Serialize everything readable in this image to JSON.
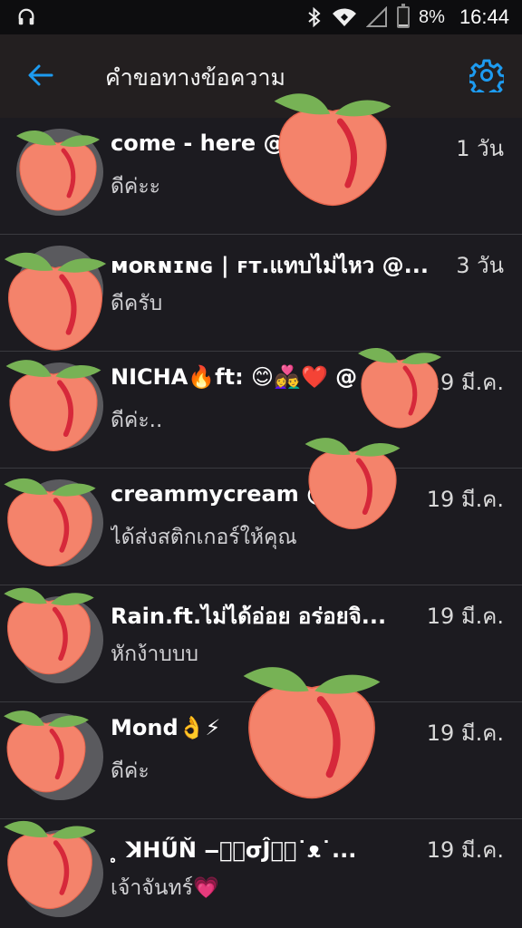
{
  "status_bar": {
    "battery_percent": "8%",
    "battery_level": 0.08,
    "time": "16:44",
    "icons": [
      "headset-icon",
      "bluetooth-icon",
      "wifi-icon",
      "signal-icon",
      "battery-icon"
    ]
  },
  "app_bar": {
    "title": "คำขอทางข้อความ",
    "back_icon": "arrow-left-icon",
    "settings_icon": "gear-icon"
  },
  "colors": {
    "accent": "#1d9bf0",
    "background": "#1c1b20",
    "peach": "#f4836b",
    "leaf": "#77b255"
  },
  "messages": [
    {
      "name": "come - here @",
      "time": "1 วัน",
      "preview": "ดีค่ะะ"
    },
    {
      "name": "ᴍᴏʀɴɪɴɢ | ꜰᴛ.แทบไม่ไหว @...",
      "time": "3 วัน",
      "preview": "ดีครับ"
    },
    {
      "name": "NICHA🔥ft: 😊👩‍❤️‍👨❤️ @",
      "time": "19 มี.ค.",
      "preview": "ดีค่ะ.."
    },
    {
      "name": "creammycream @",
      "time": "19 มี.ค.",
      "preview": "ได้ส่งสติกเกอร์ให้คุณ"
    },
    {
      "name": "Rain.ft.ไม่ได้อ่อย อร่อยจิ...",
      "time": "19 มี.ค.",
      "preview": "หักง้าบบบ"
    },
    {
      "name": "Mond👌⚡",
      "time": "19 มี.ค.",
      "preview": "ดีค่ะ"
    },
    {
      "name": "⃝⃝ ̥ ꓘHŰŇ ‒⃝⃝σĴ⃝⃝˙ᴥ˙...",
      "time": "19 มี.ค.",
      "preview": "เจ้าจันทร์💗"
    }
  ],
  "stickers": [
    "peach-sticker"
  ]
}
